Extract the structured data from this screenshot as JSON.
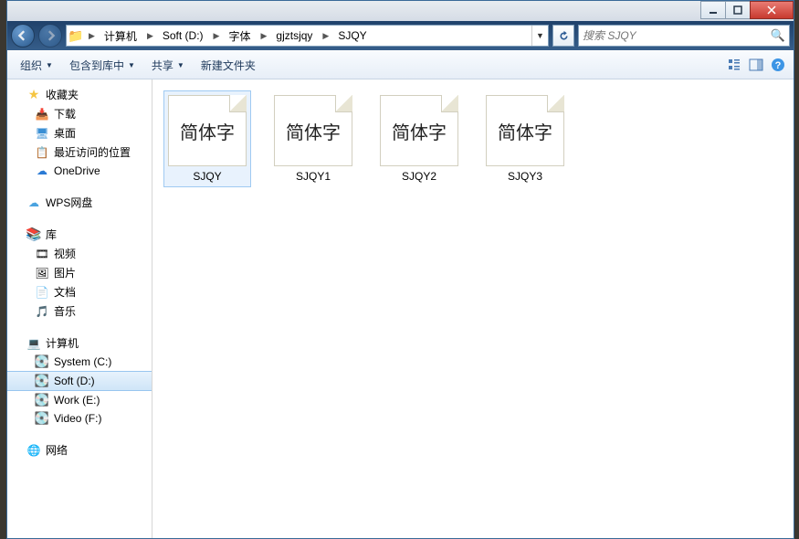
{
  "titlebar": {},
  "nav": {
    "crumbs": [
      "计算机",
      "Soft (D:)",
      "字体",
      "gjztsjqy",
      "SJQY"
    ]
  },
  "search": {
    "placeholder": "搜索 SJQY"
  },
  "toolbar": {
    "organize": "组织",
    "include": "包含到库中",
    "share": "共享",
    "newfolder": "新建文件夹"
  },
  "sidebar": {
    "favorites": {
      "label": "收藏夹",
      "items": [
        "下载",
        "桌面",
        "最近访问的位置",
        "OneDrive"
      ]
    },
    "wps": {
      "label": "WPS网盘"
    },
    "libraries": {
      "label": "库",
      "items": [
        "视频",
        "图片",
        "文档",
        "音乐"
      ]
    },
    "computer": {
      "label": "计算机",
      "items": [
        "System (C:)",
        "Soft (D:)",
        "Work (E:)",
        "Video (F:)"
      ],
      "selected": "Soft (D:)"
    },
    "network": {
      "label": "网络"
    }
  },
  "files": {
    "preview_text": "简体字",
    "items": [
      "SJQY",
      "SJQY1",
      "SJQY2",
      "SJQY3"
    ],
    "selected": "SJQY"
  }
}
